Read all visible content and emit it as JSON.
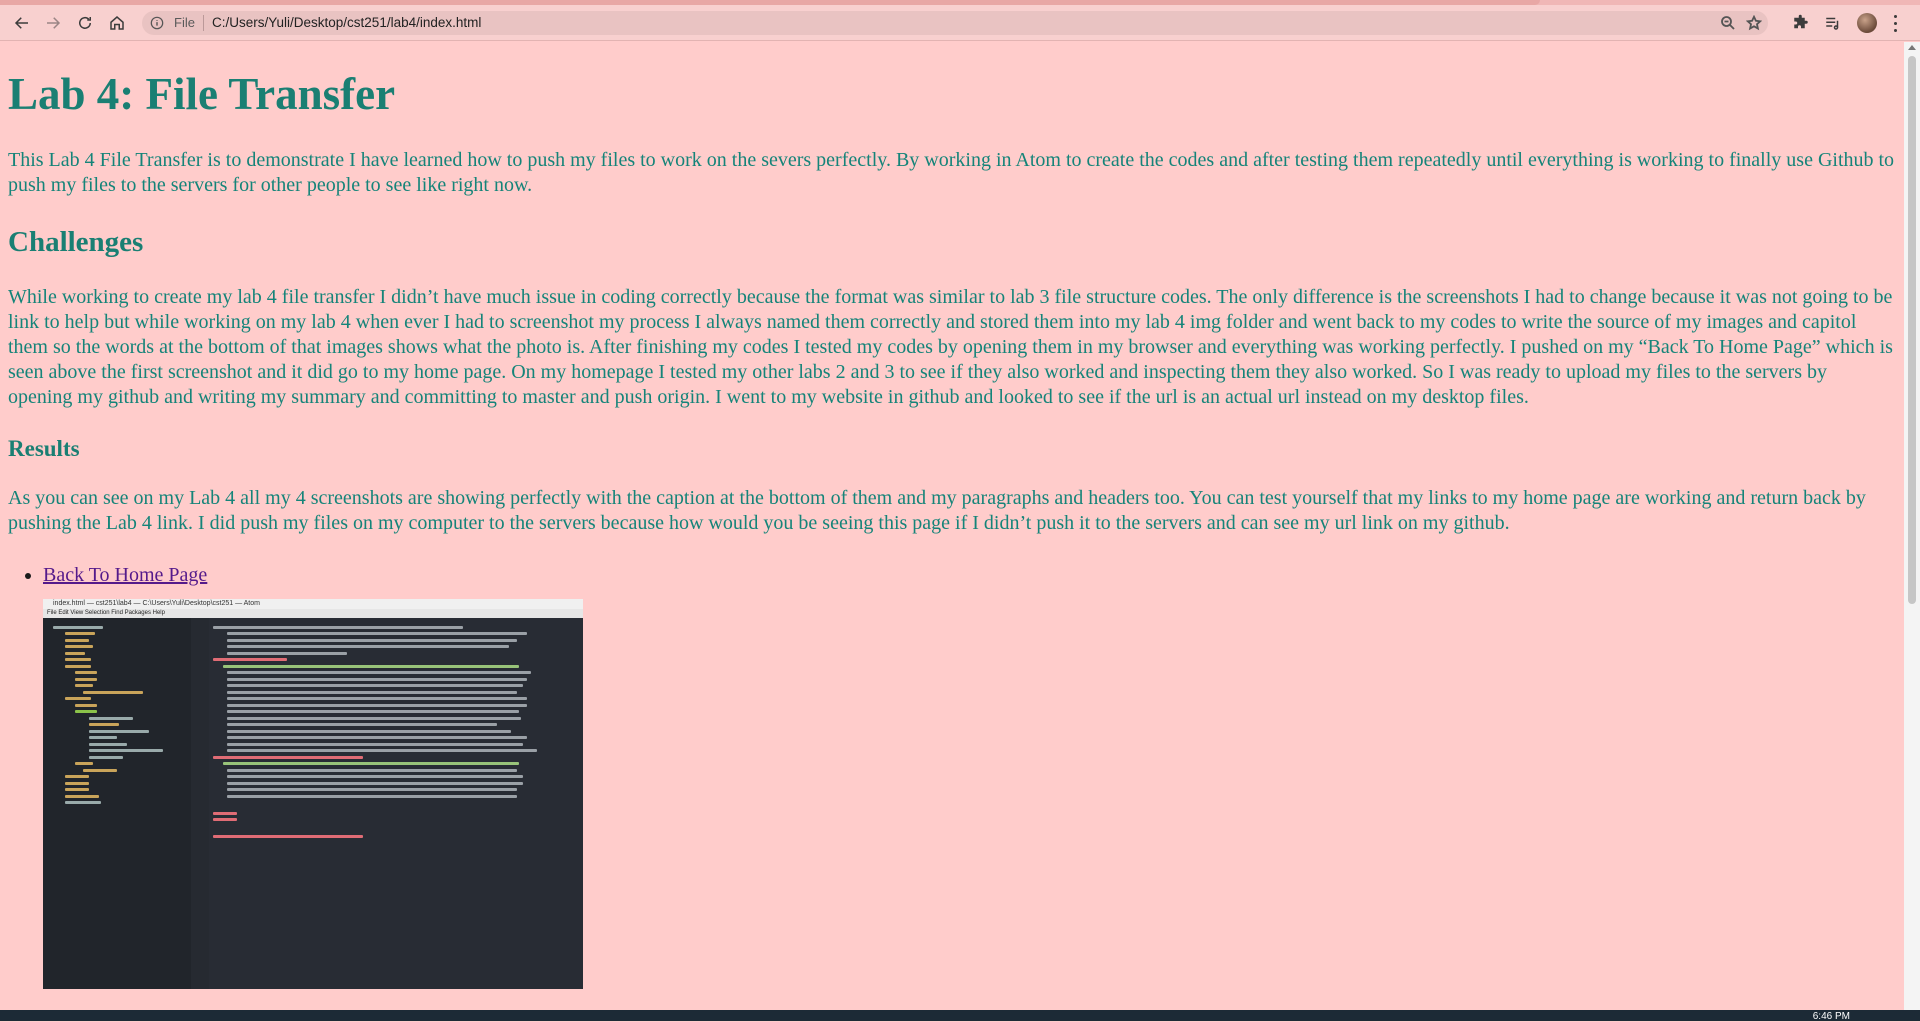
{
  "browser": {
    "scheme": "File",
    "url": "C:/Users/Yuli/Desktop/cst251/lab4/index.html"
  },
  "page": {
    "title": "Lab 4: File Transfer",
    "intro": "This Lab 4 File Transfer is to demonstrate I have learned how to push my files to work on the severs perfectly. By working in Atom to create the codes and after testing them repeatedly until everything is working to finally use Github to push my files to the servers for other people to see like right now.",
    "challenges_heading": "Challenges",
    "challenges_text": "While working to create my lab 4 file transfer I didn’t have much issue in coding correctly because the format was similar to lab 3 file structure codes. The only difference is the screenshots I had to change because it was not going to be link to help but while working on my lab 4 when ever I had to screenshot my process I always named them correctly and stored them into my lab 4 img folder and went back to my codes to write the source of my images and capitol them so the words at the bottom of that images shows what the photo is. After finishing my codes I tested my codes by opening them in my browser and everything was working perfectly. I pushed on my “Back To Home Page” which is seen above the first screenshot and it did go to my home page. On my homepage I tested my other labs 2 and 3 to see if they also worked and inspecting them they also worked. So I was ready to upload my files to the servers by opening my github and writing my summary and committing to master and push origin. I went to my website in github and looked to see if the url is an actual url instead on my desktop files.",
    "results_heading": "Results",
    "results_text": "As you can see on my Lab 4 all my 4 screenshots are showing perfectly with the caption at the bottom of them and my paragraphs and headers too. You can test yourself that my links to my home page are working and return back by pushing the Lab 4 link. I did push my files on my computer to the servers because how would you be seeing this page if I didn’t push it to the servers and can see my url link on my github.",
    "home_link": "Back To Home Page"
  },
  "screenshot": {
    "window_title": "index.html — cst251\\lab4 — C:\\Users\\Yuli\\Desktop\\cst251 — Atom",
    "menu": "File  Edit  View  Selection  Find  Packages  Help"
  },
  "taskbar": {
    "clock": "6:46 PM"
  },
  "colors": {
    "background": "#ffcccb",
    "text": "#158479"
  }
}
